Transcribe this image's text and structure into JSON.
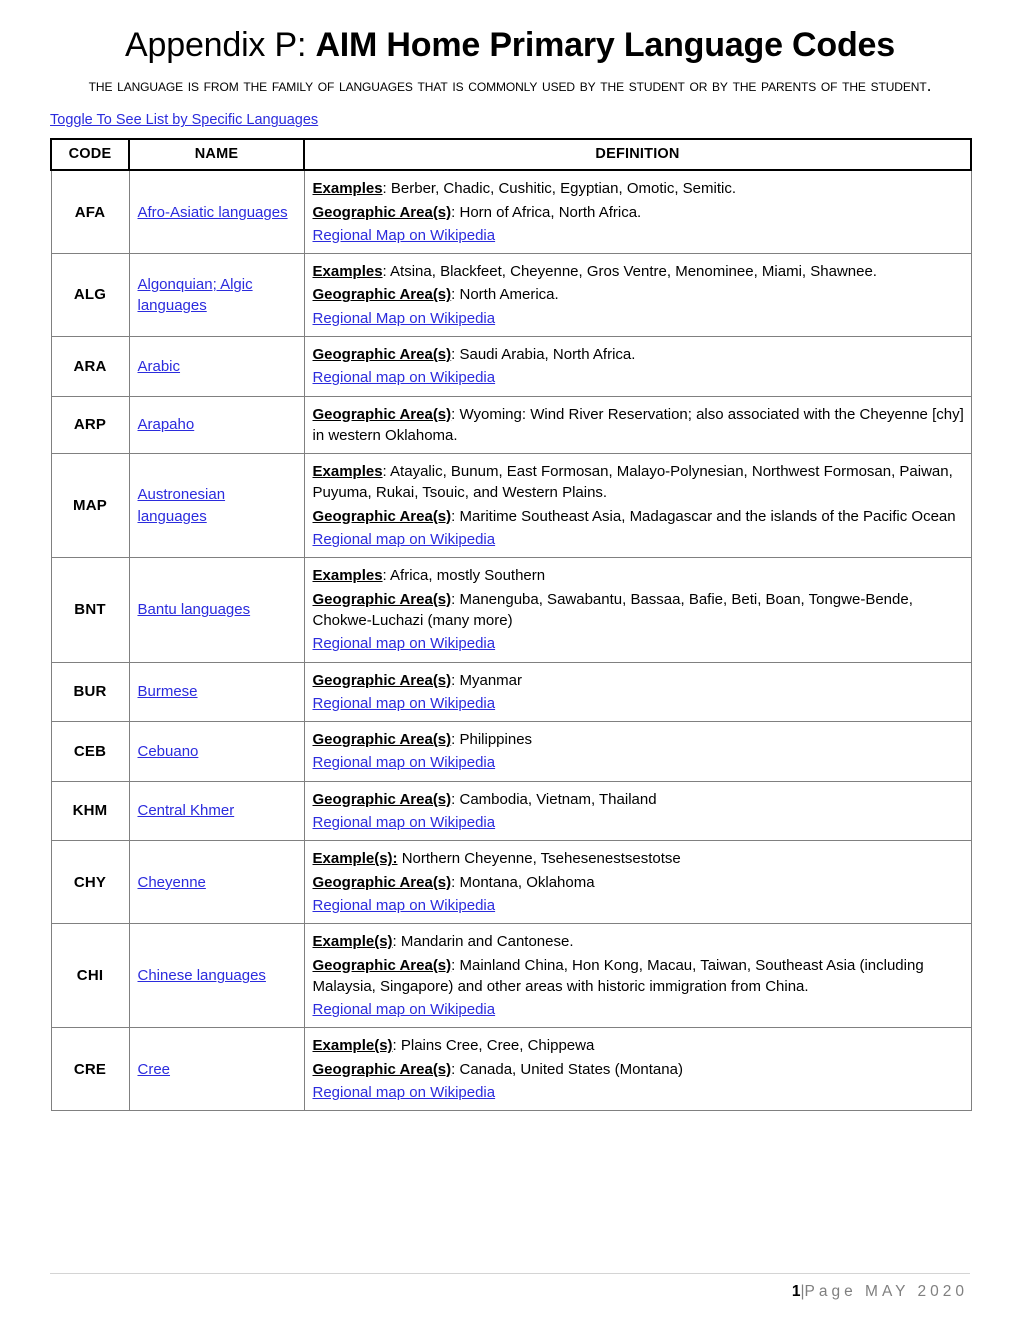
{
  "document": {
    "title_prefix": "Appendix P: ",
    "title_main": "AIM Home Primary Language Codes",
    "subtitle": "The language is from the family of languages that is commonly used by the student or by the parents of the student.",
    "toggle_link": "Toggle To See List by Specific Languages",
    "link_color": "#2b2bdd",
    "header_border_color": "#000000",
    "body_border_color": "#808080"
  },
  "table": {
    "headers": {
      "code": "CODE",
      "name": "NAME",
      "definition": "DEFINITION"
    },
    "rows": [
      {
        "code": "AFA",
        "name": "Afro-Asiatic languages",
        "examples_label": "Examples",
        "examples_text": ": Berber, Chadic, Cushitic, Egyptian, Omotic, Semitic.",
        "geo_label": "Geographic Area(s)",
        "geo_text": ": Horn of Africa, North Africa.",
        "wiki": "Regional Map on Wikipedia"
      },
      {
        "code": "ALG",
        "name": "Algonquian; Algic languages",
        "examples_label": "Examples",
        "examples_text": ": Atsina, Blackfeet, Cheyenne, Gros Ventre, Menominee, Miami, Shawnee.",
        "geo_label": "Geographic Area(s)",
        "geo_text": ": North America.",
        "wiki": "Regional Map on Wikipedia"
      },
      {
        "code": "ARA",
        "name": "Arabic",
        "examples_label": "",
        "examples_text": "",
        "geo_label": "Geographic Area(s)",
        "geo_text": ": Saudi Arabia, North Africa.",
        "wiki": "Regional map on Wikipedia"
      },
      {
        "code": "ARP",
        "name": "Arapaho",
        "examples_label": "",
        "examples_text": "",
        "geo_label": "Geographic Area(s)",
        "geo_text": ": Wyoming: Wind River Reservation; also associated with the Cheyenne [chy] in western Oklahoma.",
        "wiki": ""
      },
      {
        "code": "MAP",
        "name": "Austronesian languages",
        "examples_label": "Examples",
        "examples_text": ": Atayalic, Bunum, East Formosan, Malayo-Polynesian, Northwest Formosan, Paiwan, Puyuma, Rukai, Tsouic, and Western Plains.",
        "geo_label": "Geographic Area(s)",
        "geo_text": ": Maritime Southeast Asia, Madagascar and the islands of the Pacific Ocean",
        "wiki": "Regional map on Wikipedia"
      },
      {
        "code": "BNT",
        "name": "Bantu languages",
        "examples_label": "Examples",
        "examples_text": ": Africa, mostly Southern",
        "geo_label": "Geographic Area(s)",
        "geo_text": ": Manenguba, Sawabantu, Bassaa, Bafie, Beti, Boan, Tongwe-Bende, Chokwe-Luchazi (many more)",
        "wiki": "Regional map on Wikipedia"
      },
      {
        "code": "BUR",
        "name": "Burmese",
        "examples_label": "",
        "examples_text": "",
        "geo_label": "Geographic Area(s)",
        "geo_text": ": Myanmar",
        "wiki": "Regional map on Wikipedia"
      },
      {
        "code": "CEB",
        "name": "Cebuano",
        "examples_label": "",
        "examples_text": "",
        "geo_label": "Geographic Area(s)",
        "geo_text": ": Philippines",
        "wiki": "Regional map on Wikipedia"
      },
      {
        "code": "KHM",
        "name": "Central Khmer",
        "examples_label": "",
        "examples_text": "",
        "geo_label": "Geographic Area(s)",
        "geo_text": ": Cambodia, Vietnam, Thailand",
        "wiki": "Regional map on Wikipedia"
      },
      {
        "code": "CHY",
        "name": "Cheyenne",
        "examples_label": "Example(s):",
        "examples_text": " Northern Cheyenne, Tsehesenestsestotse",
        "geo_label": "Geographic Area(s)",
        "geo_text": ": Montana, Oklahoma",
        "wiki": "Regional map on Wikipedia"
      },
      {
        "code": "CHI",
        "name": "Chinese languages",
        "examples_label": "Example(s)",
        "examples_text": ": Mandarin and Cantonese.",
        "geo_label": "Geographic Area(s)",
        "geo_text": ": Mainland China, Hon Kong, Macau, Taiwan, Southeast Asia (including Malaysia, Singapore) and other areas with historic immigration from China.",
        "wiki": "Regional map on Wikipedia"
      },
      {
        "code": "CRE",
        "name": "Cree",
        "examples_label": "Example(s)",
        "examples_text": ": Plains Cree, Cree, Chippewa",
        "geo_label": "Geographic Area(s)",
        "geo_text": ": Canada, United States (Montana)",
        "wiki": "Regional map on Wikipedia"
      }
    ]
  },
  "footer": {
    "page_number": "1",
    "separator": "|",
    "page_label": "Page  MAY  2020"
  }
}
